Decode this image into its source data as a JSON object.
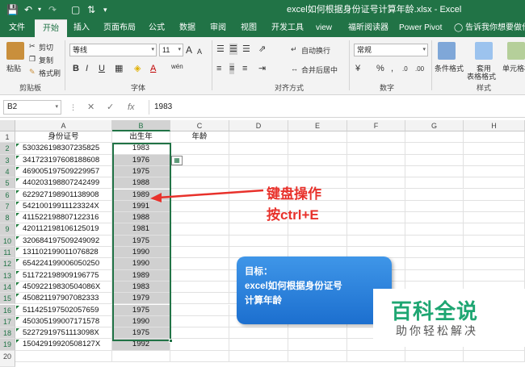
{
  "titlebar": {
    "title": "excel如何根据身份证号计算年龄.xlsx - Excel"
  },
  "tabs": [
    "文件",
    "开始",
    "插入",
    "页面布局",
    "公式",
    "数据",
    "审阅",
    "视图",
    "开发工具",
    "view",
    "福昕阅读器",
    "Power Pivot"
  ],
  "tell_me": "告诉我你想要做什么",
  "ribbon": {
    "clipboard": {
      "paste": "粘贴",
      "cut": "剪切",
      "copy": "复制",
      "format_painter": "格式刷",
      "label": "剪贴板"
    },
    "font": {
      "name": "等线",
      "size": "11",
      "bold": "B",
      "italic": "I",
      "underline": "U",
      "grow": "A",
      "shrink": "A",
      "color_a": "A",
      "wen": "wén",
      "label": "字体"
    },
    "alignment": {
      "wrap": "自动换行",
      "merge": "合并后居中",
      "label": "对齐方式"
    },
    "number": {
      "format": "常规",
      "percent": "%",
      "comma": ",",
      "label": "数字"
    },
    "styles": {
      "conditional": "条件格式",
      "table1": "套用",
      "table2": "表格格式",
      "cell": "单元格格",
      "label": "样式"
    }
  },
  "formula_bar": {
    "name_box": "B2",
    "cancel": "✕",
    "enter": "✓",
    "fx": "fx",
    "value": "1983"
  },
  "grid": {
    "columns": [
      "A",
      "B",
      "C",
      "D",
      "E",
      "F",
      "G",
      "H"
    ],
    "header_row": {
      "a": "身份证号",
      "b": "出生年",
      "c": "年龄"
    },
    "rows": [
      {
        "n": "2",
        "a": "530326198307235825",
        "b": "1983"
      },
      {
        "n": "3",
        "a": "341723197608188608",
        "b": "1976"
      },
      {
        "n": "4",
        "a": "469005197509229957",
        "b": "1975"
      },
      {
        "n": "5",
        "a": "440203198807242499",
        "b": "1988"
      },
      {
        "n": "6",
        "a": "622927198901138908",
        "b": "1989"
      },
      {
        "n": "7",
        "a": "54210019911123324X",
        "b": "1991"
      },
      {
        "n": "8",
        "a": "411522198807122316",
        "b": "1988"
      },
      {
        "n": "9",
        "a": "420112198106125019",
        "b": "1981"
      },
      {
        "n": "10",
        "a": "320684197509249092",
        "b": "1975"
      },
      {
        "n": "11",
        "a": "131102199011076828",
        "b": "1990"
      },
      {
        "n": "12",
        "a": "654224199006050250",
        "b": "1990"
      },
      {
        "n": "13",
        "a": "511722198909196775",
        "b": "1989"
      },
      {
        "n": "14",
        "a": "45092219830504086X",
        "b": "1983"
      },
      {
        "n": "15",
        "a": "450821197907082333",
        "b": "1979"
      },
      {
        "n": "16",
        "a": "511425197502057659",
        "b": "1975"
      },
      {
        "n": "17",
        "a": "450305199007171578",
        "b": "1990"
      },
      {
        "n": "18",
        "a": "52272919751113098X",
        "b": "1975"
      },
      {
        "n": "19",
        "a": "15042919920508127X",
        "b": "1992"
      }
    ],
    "last_row": "20"
  },
  "annotation": {
    "line1": "键盘操作",
    "line2": "按ctrl+E",
    "color": "#e8312b"
  },
  "callout": {
    "line1": "目标：",
    "line2": "excel如何根据身份证号",
    "line3": "计算年龄"
  },
  "watermark": {
    "big": "百科全说",
    "small": "助你轻松解决"
  },
  "colors": {
    "excel_green": "#217346",
    "watermark_green": "#1ea672"
  }
}
